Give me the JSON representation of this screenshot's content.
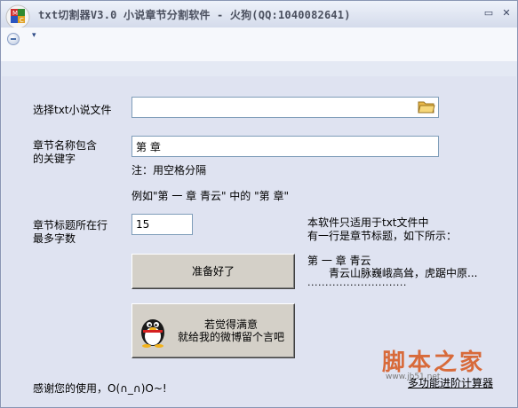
{
  "window": {
    "title": "txt切割器V3.0 小说章节分割软件 - 火狗(QQ:1040082641)",
    "controls": {
      "minimize": "▭",
      "close": "✕"
    }
  },
  "toolbar": {
    "arrow": "▾"
  },
  "form": {
    "file_label": "选择txt小说文件",
    "file_value": "",
    "keyword_label_line1": "章节名称包含",
    "keyword_label_line2": "的关键字",
    "keyword_value": "第 章",
    "note": "注：用空格分隔",
    "example": "例如\"第 一 章   青云\" 中的 \"第  章\"",
    "max_label_line1": "章节标题所在行",
    "max_label_line2": "最多字数",
    "max_value": "15"
  },
  "info": {
    "line1": "本软件只适用于txt文件中",
    "line2": "有一行是章节标题，如下所示：",
    "example_title": "第 一 章   青云",
    "example_body": "青云山脉巍峨高耸，虎踞中原...",
    "dots": "............................"
  },
  "buttons": {
    "ready": "准备好了",
    "feedback_line1": "若觉得满意",
    "feedback_line2": "就给我的微博留个言吧"
  },
  "footer": {
    "thanks": "感谢您的使用，O(∩_∩)O~!",
    "calc_link": "多功能进阶计算器"
  },
  "watermark": {
    "text": "脚本之家",
    "url": "www.jb51.net"
  },
  "colors": {
    "client_bg": "#dfe3f1",
    "watermark": "#d86a3a"
  }
}
